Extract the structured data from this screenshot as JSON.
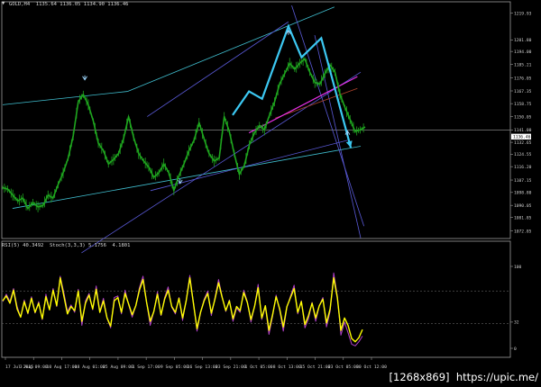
{
  "header": {
    "dropdown_glyph": "▼",
    "main_title": "GOLD,H4  1135.64 1136.05 1134.90 1136.46",
    "sub_title": "RSI(5) 40.3492  Stoch(3,3,3) 5.1756  4.1801"
  },
  "watermark": "[1268x869]  https://upic.me/",
  "colors": {
    "background": "#000000",
    "price": "#1fa51f",
    "channel_cyan": "#40bfd0",
    "channel_blue": "#5a5ad8",
    "pattern_arrow": "#3cc8f2",
    "magenta": "#e830e8",
    "brown_line": "#b0442c",
    "rsi": "#ffff00",
    "stoch": "#b040c8",
    "level_line": "#606060",
    "current_price_bg": "#ffffff"
  },
  "chart_data": [
    {
      "type": "line",
      "title": "GOLD,H4",
      "ohlc_header": [
        "1135.64",
        "1136.05",
        "1134.90",
        "1136.46"
      ],
      "current_price_label": "1136.46",
      "ylim": [
        1067.68,
        1227.52
      ],
      "y_ticks": [
        "1219.93",
        "1201.80",
        "1194.00",
        "1185.21",
        "1176.05",
        "1167.35",
        "1158.75",
        "1150.05",
        "1141.00",
        "1132.65",
        "1124.55",
        "1116.20",
        "1107.15",
        "1098.80",
        "1090.05",
        "1081.85",
        "1072.85"
      ],
      "x_ticks": [
        "17 Jul 2015",
        "3 Aug 09:00",
        "10 Aug 17:00",
        "18 Aug 01:00",
        "25 Aug 09:00",
        "1 Sep 17:00",
        "9 Sep 05:00",
        "16 Sep 13:00",
        "23 Sep 21:00",
        "1 Oct 05:00",
        "8 Oct 13:00",
        "15 Oct 21:00",
        "23 Oct 05:00",
        "30 Oct 12:00"
      ],
      "series": [
        {
          "values": [
            1102,
            1101,
            1097,
            1093,
            1095,
            1088,
            1092,
            1089,
            1090,
            1097,
            1095,
            1104,
            1112,
            1122,
            1137,
            1160,
            1165,
            1158,
            1147,
            1132,
            1127,
            1118,
            1121,
            1125,
            1135,
            1150,
            1136,
            1125,
            1120,
            1116,
            1109,
            1112,
            1118,
            1112,
            1100,
            1110,
            1118,
            1127,
            1134,
            1146,
            1135,
            1125,
            1120,
            1122,
            1150,
            1140,
            1125,
            1111,
            1117,
            1131,
            1139,
            1144,
            1141,
            1151,
            1160,
            1172,
            1179,
            1186,
            1182,
            1186,
            1189,
            1180,
            1173,
            1172,
            1179,
            1185,
            1180,
            1165,
            1156,
            1148,
            1140,
            1141,
            1143
          ]
        }
      ],
      "annotations": [
        "arrow up",
        "arrow up",
        "arrow down",
        "arrow down"
      ],
      "pattern_path": [
        [
          "2015-09-25",
          1151
        ],
        [
          "2015-09-30",
          1167
        ],
        [
          "2015-10-04",
          1162
        ],
        [
          "2015-10-12",
          1211
        ],
        [
          "2015-10-16",
          1190
        ],
        [
          "2015-10-22",
          1203
        ],
        [
          "2015-10-31",
          1129
        ]
      ]
    },
    {
      "type": "line",
      "title": "RSI(5) 40.3492  Stoch(3,3,3) 5.1756  4.1801",
      "ylim": [
        0,
        100
      ],
      "y_ticks": [
        "100",
        "32",
        "0"
      ],
      "levels": [
        70,
        30
      ],
      "series": [
        {
          "name": "RSI(5)",
          "values": [
            58,
            64,
            55,
            71,
            48,
            38,
            57,
            43,
            61,
            44,
            55,
            36,
            63,
            47,
            71,
            52,
            86,
            64,
            42,
            51,
            46,
            70,
            33,
            55,
            65,
            48,
            72,
            44,
            58,
            37,
            27,
            58,
            62,
            44,
            67,
            54,
            41,
            52,
            71,
            84,
            56,
            33,
            45,
            66,
            41,
            60,
            71,
            51,
            44,
            61,
            37,
            58,
            86,
            55,
            24,
            44,
            58,
            67,
            43,
            60,
            80,
            62,
            46,
            58,
            36,
            51,
            46,
            68,
            56,
            35,
            51,
            74,
            37,
            52,
            22,
            41,
            63,
            48,
            26,
            51,
            62,
            73,
            44,
            57,
            29,
            40,
            55,
            37,
            52,
            60,
            31,
            48,
            86,
            62,
            22,
            37,
            28,
            12,
            8,
            13,
            23
          ]
        },
        {
          "name": "Stoch",
          "values": [
            57,
            66,
            57,
            73,
            51,
            38,
            59,
            42,
            63,
            43,
            57,
            35,
            66,
            47,
            73,
            51,
            88,
            68,
            45,
            53,
            44,
            72,
            28,
            58,
            67,
            47,
            76,
            45,
            61,
            37,
            25,
            62,
            64,
            42,
            71,
            53,
            38,
            52,
            74,
            88,
            56,
            28,
            45,
            69,
            40,
            62,
            75,
            50,
            42,
            62,
            34,
            59,
            89,
            56,
            21,
            43,
            60,
            70,
            40,
            62,
            84,
            63,
            45,
            59,
            33,
            49,
            44,
            71,
            57,
            32,
            51,
            78,
            35,
            51,
            17,
            39,
            65,
            46,
            21,
            50,
            64,
            77,
            42,
            58,
            25,
            36,
            56,
            33,
            52,
            62,
            26,
            45,
            92,
            64,
            16,
            32,
            19,
            5,
            3,
            8,
            15
          ]
        }
      ]
    }
  ]
}
